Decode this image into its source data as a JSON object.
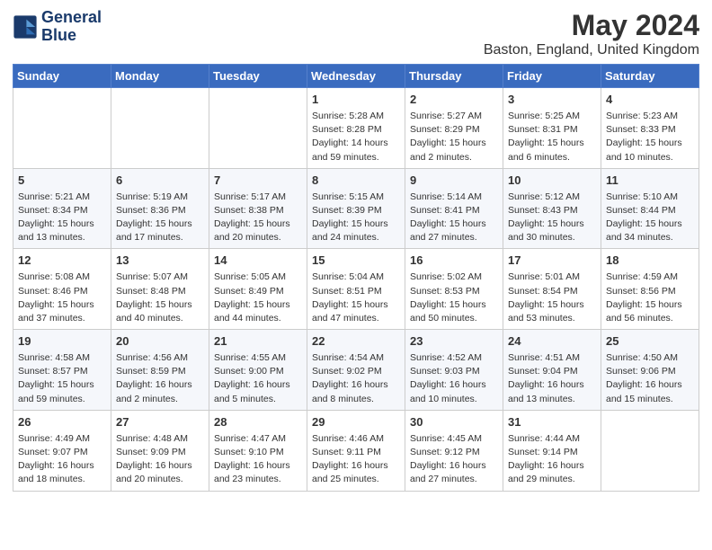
{
  "app": {
    "logo_line1": "General",
    "logo_line2": "Blue",
    "title": "May 2024",
    "subtitle": "Baston, England, United Kingdom"
  },
  "calendar": {
    "headers": [
      "Sunday",
      "Monday",
      "Tuesday",
      "Wednesday",
      "Thursday",
      "Friday",
      "Saturday"
    ],
    "weeks": [
      [
        {
          "day": "",
          "info": ""
        },
        {
          "day": "",
          "info": ""
        },
        {
          "day": "",
          "info": ""
        },
        {
          "day": "1",
          "info": "Sunrise: 5:28 AM\nSunset: 8:28 PM\nDaylight: 14 hours\nand 59 minutes."
        },
        {
          "day": "2",
          "info": "Sunrise: 5:27 AM\nSunset: 8:29 PM\nDaylight: 15 hours\nand 2 minutes."
        },
        {
          "day": "3",
          "info": "Sunrise: 5:25 AM\nSunset: 8:31 PM\nDaylight: 15 hours\nand 6 minutes."
        },
        {
          "day": "4",
          "info": "Sunrise: 5:23 AM\nSunset: 8:33 PM\nDaylight: 15 hours\nand 10 minutes."
        }
      ],
      [
        {
          "day": "5",
          "info": "Sunrise: 5:21 AM\nSunset: 8:34 PM\nDaylight: 15 hours\nand 13 minutes."
        },
        {
          "day": "6",
          "info": "Sunrise: 5:19 AM\nSunset: 8:36 PM\nDaylight: 15 hours\nand 17 minutes."
        },
        {
          "day": "7",
          "info": "Sunrise: 5:17 AM\nSunset: 8:38 PM\nDaylight: 15 hours\nand 20 minutes."
        },
        {
          "day": "8",
          "info": "Sunrise: 5:15 AM\nSunset: 8:39 PM\nDaylight: 15 hours\nand 24 minutes."
        },
        {
          "day": "9",
          "info": "Sunrise: 5:14 AM\nSunset: 8:41 PM\nDaylight: 15 hours\nand 27 minutes."
        },
        {
          "day": "10",
          "info": "Sunrise: 5:12 AM\nSunset: 8:43 PM\nDaylight: 15 hours\nand 30 minutes."
        },
        {
          "day": "11",
          "info": "Sunrise: 5:10 AM\nSunset: 8:44 PM\nDaylight: 15 hours\nand 34 minutes."
        }
      ],
      [
        {
          "day": "12",
          "info": "Sunrise: 5:08 AM\nSunset: 8:46 PM\nDaylight: 15 hours\nand 37 minutes."
        },
        {
          "day": "13",
          "info": "Sunrise: 5:07 AM\nSunset: 8:48 PM\nDaylight: 15 hours\nand 40 minutes."
        },
        {
          "day": "14",
          "info": "Sunrise: 5:05 AM\nSunset: 8:49 PM\nDaylight: 15 hours\nand 44 minutes."
        },
        {
          "day": "15",
          "info": "Sunrise: 5:04 AM\nSunset: 8:51 PM\nDaylight: 15 hours\nand 47 minutes."
        },
        {
          "day": "16",
          "info": "Sunrise: 5:02 AM\nSunset: 8:53 PM\nDaylight: 15 hours\nand 50 minutes."
        },
        {
          "day": "17",
          "info": "Sunrise: 5:01 AM\nSunset: 8:54 PM\nDaylight: 15 hours\nand 53 minutes."
        },
        {
          "day": "18",
          "info": "Sunrise: 4:59 AM\nSunset: 8:56 PM\nDaylight: 15 hours\nand 56 minutes."
        }
      ],
      [
        {
          "day": "19",
          "info": "Sunrise: 4:58 AM\nSunset: 8:57 PM\nDaylight: 15 hours\nand 59 minutes."
        },
        {
          "day": "20",
          "info": "Sunrise: 4:56 AM\nSunset: 8:59 PM\nDaylight: 16 hours\nand 2 minutes."
        },
        {
          "day": "21",
          "info": "Sunrise: 4:55 AM\nSunset: 9:00 PM\nDaylight: 16 hours\nand 5 minutes."
        },
        {
          "day": "22",
          "info": "Sunrise: 4:54 AM\nSunset: 9:02 PM\nDaylight: 16 hours\nand 8 minutes."
        },
        {
          "day": "23",
          "info": "Sunrise: 4:52 AM\nSunset: 9:03 PM\nDaylight: 16 hours\nand 10 minutes."
        },
        {
          "day": "24",
          "info": "Sunrise: 4:51 AM\nSunset: 9:04 PM\nDaylight: 16 hours\nand 13 minutes."
        },
        {
          "day": "25",
          "info": "Sunrise: 4:50 AM\nSunset: 9:06 PM\nDaylight: 16 hours\nand 15 minutes."
        }
      ],
      [
        {
          "day": "26",
          "info": "Sunrise: 4:49 AM\nSunset: 9:07 PM\nDaylight: 16 hours\nand 18 minutes."
        },
        {
          "day": "27",
          "info": "Sunrise: 4:48 AM\nSunset: 9:09 PM\nDaylight: 16 hours\nand 20 minutes."
        },
        {
          "day": "28",
          "info": "Sunrise: 4:47 AM\nSunset: 9:10 PM\nDaylight: 16 hours\nand 23 minutes."
        },
        {
          "day": "29",
          "info": "Sunrise: 4:46 AM\nSunset: 9:11 PM\nDaylight: 16 hours\nand 25 minutes."
        },
        {
          "day": "30",
          "info": "Sunrise: 4:45 AM\nSunset: 9:12 PM\nDaylight: 16 hours\nand 27 minutes."
        },
        {
          "day": "31",
          "info": "Sunrise: 4:44 AM\nSunset: 9:14 PM\nDaylight: 16 hours\nand 29 minutes."
        },
        {
          "day": "",
          "info": ""
        }
      ]
    ]
  }
}
